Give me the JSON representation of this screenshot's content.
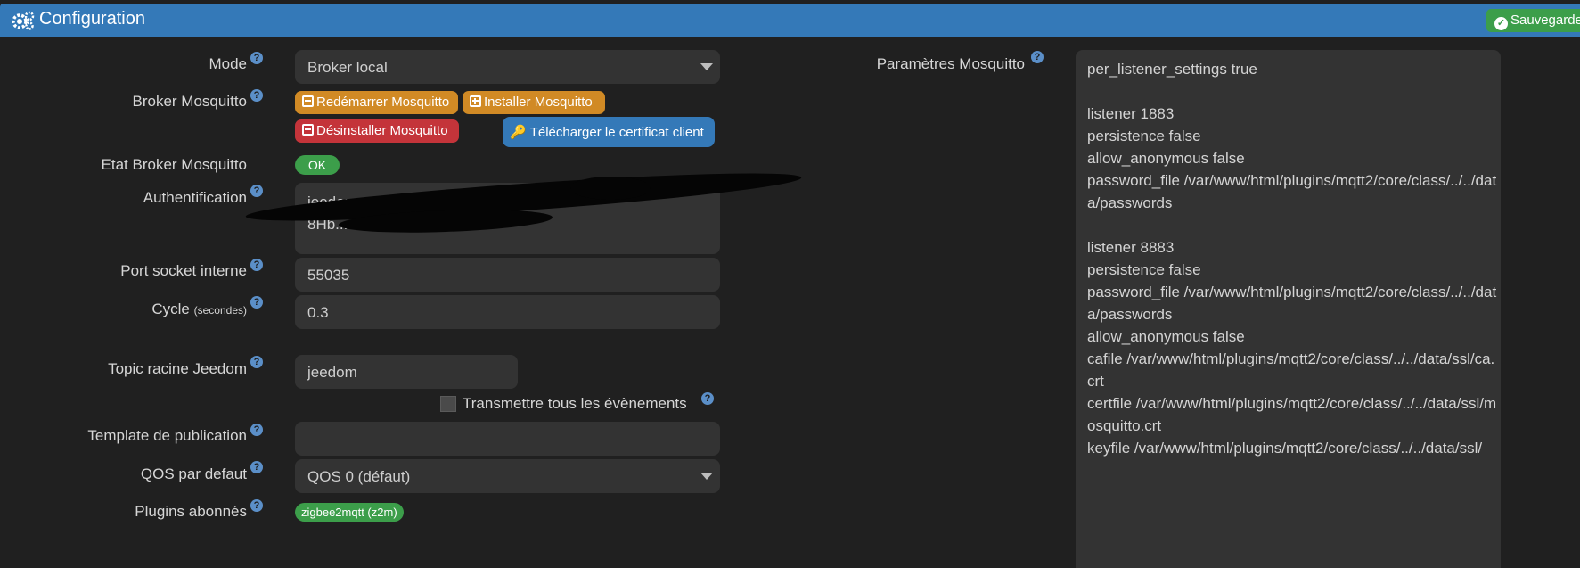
{
  "header": {
    "title": "Configuration",
    "save_label": "Sauvegarder"
  },
  "form": {
    "mode_label": "Mode",
    "mode_value": "Broker local",
    "broker_label": "Broker Mosquitto",
    "btn_restart": "Redémarrer Mosquitto",
    "btn_install": "Installer Mosquitto",
    "btn_uninstall": "Désinstaller Mosquitto",
    "btn_download_cert": "Télécharger le certificat client",
    "state_label": "Etat Broker Mosquitto",
    "state_value": "OK",
    "auth_label": "Authentification",
    "auth_line1": "jeedom:r...",
    "auth_line2": "8Hb...",
    "port_label": "Port socket interne",
    "port_value": "55035",
    "cycle_label": "Cycle",
    "cycle_unit": "(secondes)",
    "cycle_value": "0.3",
    "topic_label": "Topic racine Jeedom",
    "topic_value": "jeedom",
    "send_all_label": "Transmettre tous les évènements",
    "template_label": "Template de publication",
    "template_value": "",
    "qos_label": "QOS par defaut",
    "qos_value": "QOS 0 (défaut)",
    "plugins_label": "Plugins abonnés",
    "plugin_badge": "zigbee2mqtt (z2m)"
  },
  "mosquitto": {
    "label": "Paramètres Mosquitto",
    "content": "per_listener_settings true\n\nlistener 1883\npersistence false\nallow_anonymous false\npassword_file /var/www/html/plugins/mqtt2/core/class/../../data/passwords\n\nlistener 8883\npersistence false\npassword_file /var/www/html/plugins/mqtt2/core/class/../../data/passwords\nallow_anonymous false\ncafile /var/www/html/plugins/mqtt2/core/class/../../data/ssl/ca.crt\ncertfile /var/www/html/plugins/mqtt2/core/class/../../data/ssl/mosquitto.crt\nkeyfile /var/www/html/plugins/mqtt2/core/class/../../data/ssl/"
  },
  "icons": {
    "header": "gears-icon",
    "help": "question-circle-icon",
    "save": "check-circle-icon",
    "download": "key-icon"
  },
  "colors": {
    "header_bg": "#3479b8",
    "success": "#3c9e4a",
    "warning": "#d18a25",
    "danger": "#c4343a",
    "field_bg": "#333333",
    "page_bg": "#202020"
  }
}
